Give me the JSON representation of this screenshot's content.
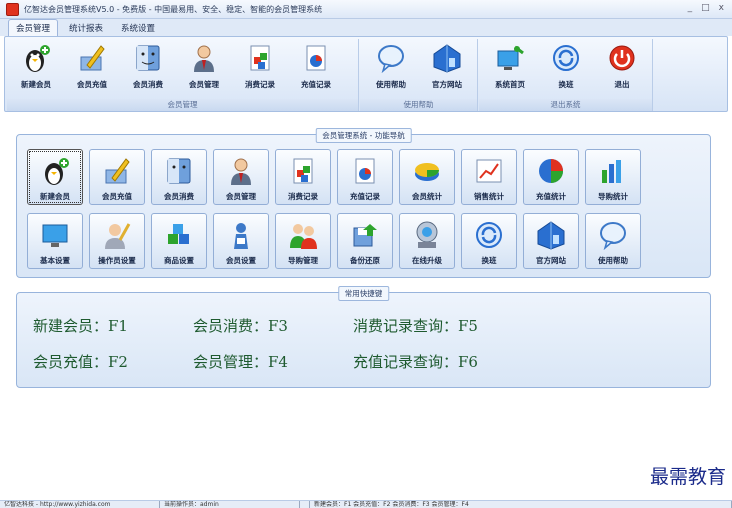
{
  "window": {
    "title": "亿智达会员管理系统V5.0 - 免费版 - 中国最易用、安全、稳定、智能的会员管理系统",
    "controls": [
      "_",
      "□",
      "x"
    ]
  },
  "tabs": [
    "会员管理",
    "统计报表",
    "系统设置"
  ],
  "ribbon": {
    "groups": [
      {
        "label": "会员管理",
        "buttons": [
          {
            "label": "新建会员",
            "icon": "penguin-add-icon"
          },
          {
            "label": "会员充值",
            "icon": "pen-recharge-icon"
          },
          {
            "label": "会员消费",
            "icon": "mac-face-icon"
          },
          {
            "label": "会员管理",
            "icon": "person-manager-icon"
          },
          {
            "label": "消费记录",
            "icon": "doc-cubes-icon"
          },
          {
            "label": "充值记录",
            "icon": "doc-pie-icon"
          }
        ]
      },
      {
        "label": "使用帮助",
        "buttons": [
          {
            "label": "使用帮助",
            "icon": "speech-bubble-icon"
          },
          {
            "label": "官方网站",
            "icon": "house-icon"
          }
        ]
      },
      {
        "label": "退出系统",
        "buttons": [
          {
            "label": "系统首页",
            "icon": "monitor-home-icon"
          },
          {
            "label": "换班",
            "icon": "refresh-icon"
          },
          {
            "label": "退出",
            "icon": "power-icon"
          }
        ]
      }
    ]
  },
  "nav_panel": {
    "title": "会员管理系统 - 功能导航",
    "row1": [
      {
        "label": "新建会员",
        "icon": "penguin-add-icon"
      },
      {
        "label": "会员充值",
        "icon": "pen-recharge-icon"
      },
      {
        "label": "会员消费",
        "icon": "mac-face-icon"
      },
      {
        "label": "会员管理",
        "icon": "person-manager-icon"
      },
      {
        "label": "消费记录",
        "icon": "doc-cubes-icon"
      },
      {
        "label": "充值记录",
        "icon": "doc-pie-icon"
      },
      {
        "label": "会员统计",
        "icon": "pie3d-icon"
      },
      {
        "label": "销售统计",
        "icon": "line-chart-icon"
      },
      {
        "label": "充值统计",
        "icon": "pie-icon"
      },
      {
        "label": "导购统计",
        "icon": "bar-chart-icon"
      }
    ],
    "row2": [
      {
        "label": "基本设置",
        "icon": "monitor-icon"
      },
      {
        "label": "操作员设置",
        "icon": "operator-icon"
      },
      {
        "label": "商品设置",
        "icon": "cubes-icon"
      },
      {
        "label": "会员设置",
        "icon": "member-icon"
      },
      {
        "label": "导购管理",
        "icon": "people-icon"
      },
      {
        "label": "备份还原",
        "icon": "backup-icon"
      },
      {
        "label": "在线升级",
        "icon": "upgrade-icon"
      },
      {
        "label": "换班",
        "icon": "refresh-icon"
      },
      {
        "label": "官方网站",
        "icon": "house-icon"
      },
      {
        "label": "使用帮助",
        "icon": "speech-bubble-icon"
      }
    ]
  },
  "shortcuts_panel": {
    "title": "常用快捷键",
    "items": [
      "新建会员：F1",
      "会员消费：F3",
      "消费记录查询：F5",
      "会员充值：F2",
      "会员管理：F4",
      "充值记录查询：F6"
    ]
  },
  "watermark": "最需教育",
  "statusbar": [
    "亿智达科技 - http://www.yizhida.com",
    "当前操作员：admin",
    "",
    "新建会员：F1  会员充值：F2  会员消费：F3  会员管理：F4"
  ],
  "colors": {
    "accent": "#98b4dc",
    "shortcut_text": "#1e5a2f",
    "exit_red": "#e0321e"
  }
}
